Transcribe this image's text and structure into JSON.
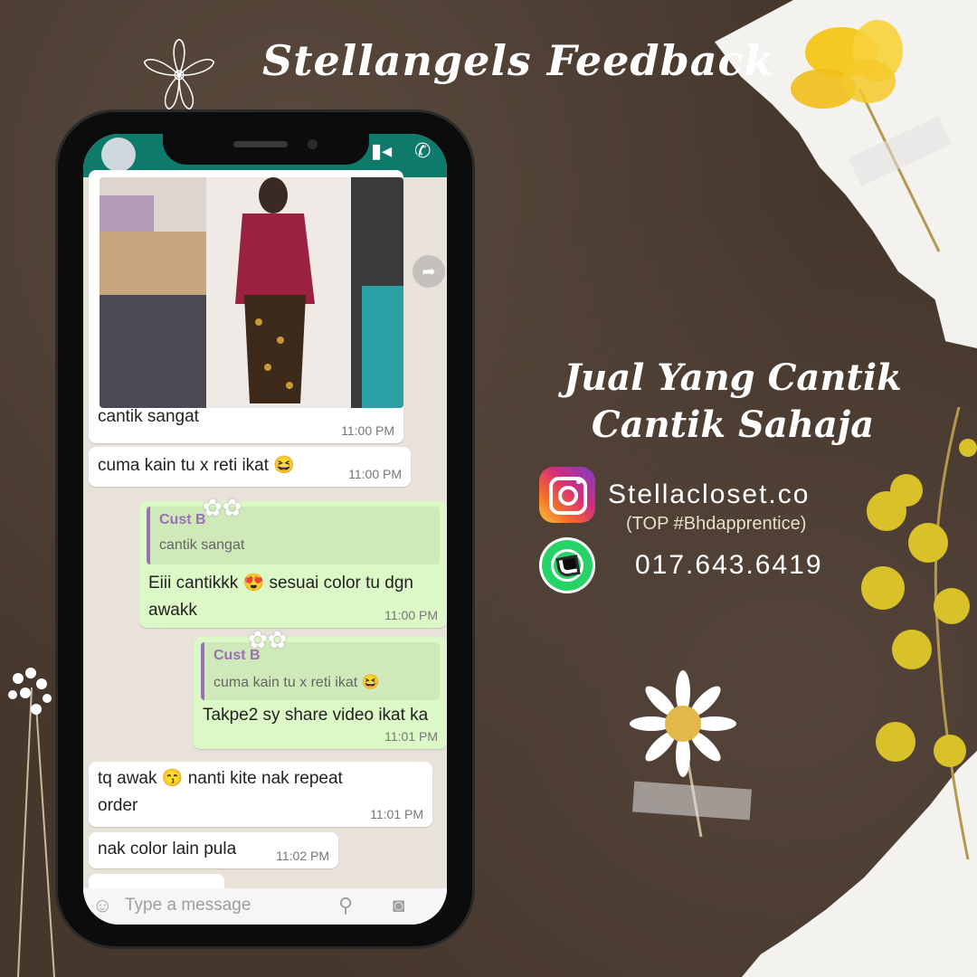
{
  "title": "Stellangels Feedback",
  "tagline": [
    "Jual Yang Cantik",
    "Cantik Sahaja"
  ],
  "contact": {
    "instagram_handle": "Stellacloset.co",
    "instagram_sub": "(TOP #Bhdapprentice)",
    "whatsapp_number": "017.643.6419",
    "instagram_icon": "instagram-icon",
    "whatsapp_icon": "whatsapp-icon"
  },
  "chat": {
    "messages": [
      {
        "id": "m1",
        "dir": "in",
        "text": "cantik sangat",
        "time": "11:00 PM",
        "has_photo": true
      },
      {
        "id": "m2",
        "dir": "in",
        "text": "cuma kain tu x reti ikat 😆",
        "time": "11:00 PM"
      },
      {
        "id": "m3",
        "dir": "out",
        "quote_name": "Cust B",
        "quote_text": "cantik sangat",
        "text": "Eiii cantikkk 😍 sesuai color tu dgn",
        "text2": "awakk",
        "time": "11:00 PM"
      },
      {
        "id": "m4",
        "dir": "out",
        "quote_name": "Cust B",
        "quote_text": "cuma kain tu x reti ikat 😆",
        "text": "Takpe2 sy share video ikat ka",
        "time": "11:01 PM"
      },
      {
        "id": "m5",
        "dir": "in",
        "text": "tq awak 😙 nanti kite nak repeat",
        "text2": "order",
        "time": "11:01 PM"
      },
      {
        "id": "m6",
        "dir": "in",
        "text": "nak color lain pula",
        "time": "11:02 PM"
      }
    ],
    "input_placeholder": "Type a message"
  },
  "colors": {
    "background": "#46372d",
    "whatsapp_header": "#0d7a6b",
    "incoming_bubble": "#ffffff",
    "outgoing_bubble": "#dcf8c6",
    "quote_accent": "#9b6fb5"
  }
}
